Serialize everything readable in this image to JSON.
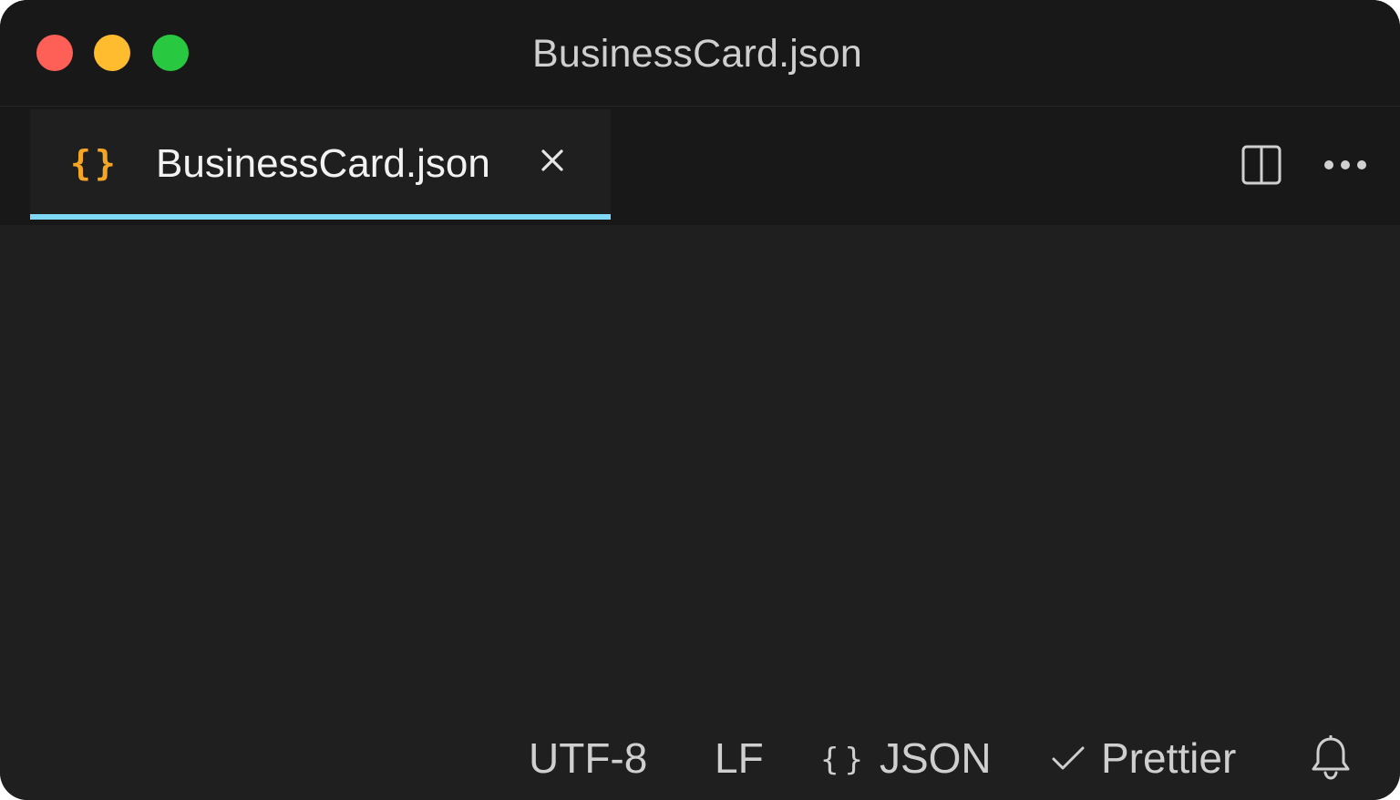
{
  "window": {
    "title": "BusinessCard.json"
  },
  "tabs": [
    {
      "label": "BusinessCard.json",
      "icon": "json-braces-icon",
      "icon_glyph": "{}",
      "active": true,
      "accent_color": "#7fd8f7",
      "icon_color": "#f5a524"
    }
  ],
  "toolbar": {
    "split_editor_icon": "split-editor-icon",
    "more_actions_icon": "more-actions-icon"
  },
  "statusbar": {
    "encoding": "UTF-8",
    "eol": "LF",
    "language_glyph": "{}",
    "language": "JSON",
    "formatter": "Prettier",
    "notifications_icon": "bell-icon"
  },
  "colors": {
    "traffic_close": "#fe5f57",
    "traffic_minimize": "#febc2e",
    "traffic_maximize": "#28c840",
    "background": "#1f1f1f",
    "titlebar": "#181818"
  }
}
